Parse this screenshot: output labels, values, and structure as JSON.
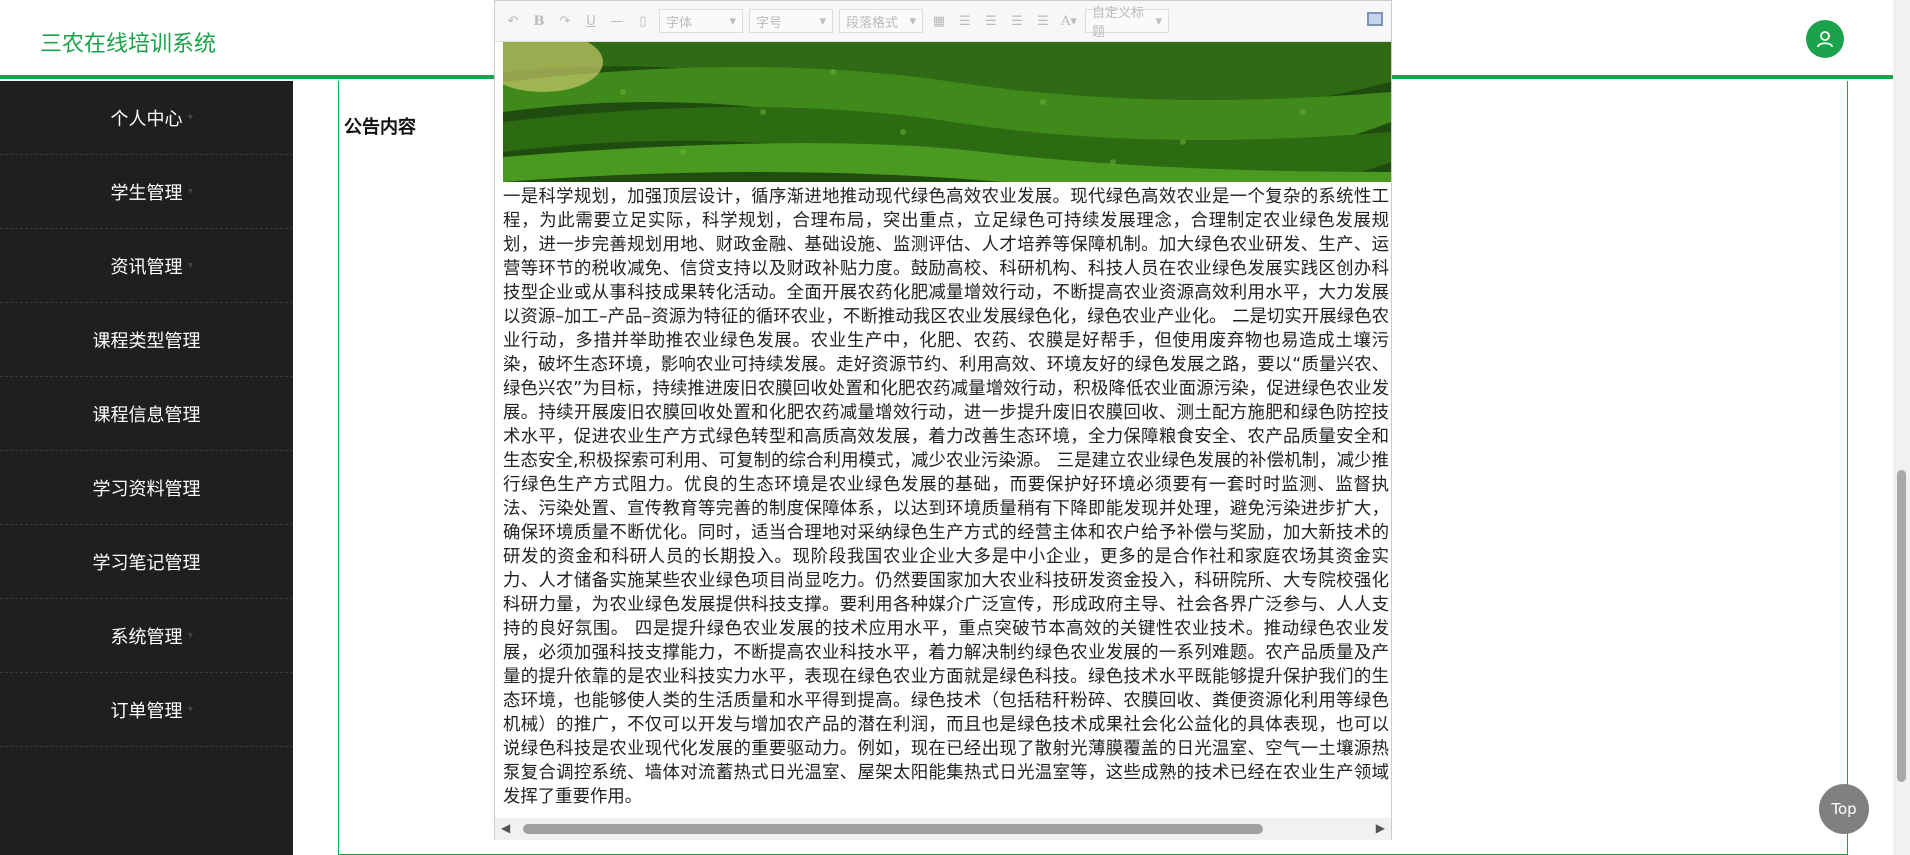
{
  "app": {
    "title": "三农在线培训系统"
  },
  "sidebar": {
    "items": [
      {
        "label": "个人中心"
      },
      {
        "label": "学生管理"
      },
      {
        "label": "资讯管理"
      },
      {
        "label": "课程类型管理"
      },
      {
        "label": "课程信息管理"
      },
      {
        "label": "学习资料管理"
      },
      {
        "label": "学习笔记管理"
      },
      {
        "label": "系统管理"
      },
      {
        "label": "订单管理"
      }
    ]
  },
  "form": {
    "content_label": "公告内容"
  },
  "editor": {
    "toolbar": {
      "font_placeholder": "字体",
      "size_placeholder": "字号",
      "paragraph_placeholder": "段落格式",
      "custom_title_placeholder": "自定义标题"
    },
    "content_text": "一是科学规划，加强顶层设计，循序渐进地推动现代绿色高效农业发展。现代绿色高效农业是一个复杂的系统性工程，为此需要立足实际，科学规划，合理布局，突出重点，立足绿色可持续发展理念，合理制定农业绿色发展规划，进一步完善规划用地、财政金融、基础设施、监测评估、人才培养等保障机制。加大绿色农业研发、生产、运营等环节的税收减免、信贷支持以及财政补贴力度。鼓励高校、科研机构、科技人员在农业绿色发展实践区创办科技型企业或从事科技成果转化活动。全面开展农药化肥减量增效行动，不断提高农业资源高效利用水平，大力发展以资源–加工–产品–资源为特征的循环农业，不断推动我区农业发展绿色化，绿色农业产业化。 二是切实开展绿色农业行动，多措并举助推农业绿色发展。农业生产中，化肥、农药、农膜是好帮手，但使用废弃物也易造成土壤污染，破坏生态环境，影响农业可持续发展。走好资源节约、利用高效、环境友好的绿色发展之路，要以“质量兴农、绿色兴农”为目标，持续推进废旧农膜回收处置和化肥农药减量增效行动，积极降低农业面源污染，促进绿色农业发展。持续开展废旧农膜回收处置和化肥农药减量增效行动，进一步提升废旧农膜回收、测土配方施肥和绿色防控技术水平，促进农业生产方式绿色转型和高质高效发展，着力改善生态环境，全力保障粮食安全、农产品质量安全和生态安全,积极探索可利用、可复制的综合利用模式，减少农业污染源。 三是建立农业绿色发展的补偿机制，减少推行绿色生产方式阻力。优良的生态环境是农业绿色发展的基础，而要保护好环境必须要有一套时时监测、监督执法、污染处置、宣传教育等完善的制度保障体系，以达到环境质量稍有下降即能发现并处理，避免污染进步扩大，确保环境质量不断优化。同时，适当合理地对采纳绿色生产方式的经营主体和农户给予补偿与奖励，加大新技术的研发的资金和科研人员的长期投入。现阶段我国农业企业大多是中小企业，更多的是合作社和家庭农场其资金实力、人才储备实施某些农业绿色项目尚显吃力。仍然要国家加大农业科技研发资金投入，科研院所、大专院校强化科研力量，为农业绿色发展提供科技支撑。要利用各种媒介广泛宣传，形成政府主导、社会各界广泛参与、人人支持的良好氛围。 四是提升绿色农业发展的技术应用水平，重点突破节本高效的关键性农业技术。推动绿色农业发展，必须加强科技支撑能力，不断提高农业科技水平，着力解决制约绿色农业发展的一系列难题。农产品质量及产量的提升依靠的是农业科技实力水平，表现在绿色农业方面就是绿色科技。绿色技术水平既能够提升保护我们的生态环境，也能够使人类的生活质量和水平得到提高。绿色技术（包括秸秆粉碎、农膜回收、粪便资源化利用等绿色机械）的推广，不仅可以开发与增加农产品的潜在利润，而且也是绿色技术成果社会化公益化的具体表现，也可以说绿色科技是农业现代化发展的重要驱动力。例如，现在已经出现了散射光薄膜覆盖的日光温室、空气一土壤源热泵复合调控系统、墙体对流蓄热式日光温室、屋架太阳能集热式日光温室等，这些成熟的技术已经在农业生产领域发挥了重要作用。"
  },
  "top_button": {
    "label": "Top"
  }
}
